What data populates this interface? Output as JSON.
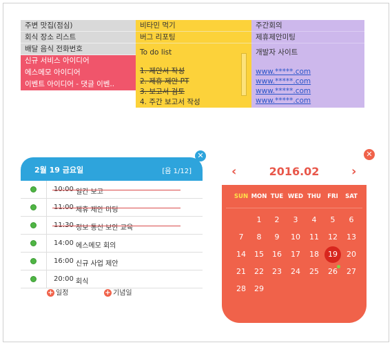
{
  "notes": {
    "col1": {
      "gray_items": [
        "주변 맛집(점심)",
        "회식 장소 리스트",
        "배달 음식 전화번호"
      ],
      "red_items": [
        "신규 서비스 아이디어",
        "에스메모 아이디어",
        "이벤트 아이디어 - 댓글 이벤.."
      ]
    },
    "col2": {
      "items": [
        "비타민 먹기",
        "버그 리포팅"
      ],
      "todo": {
        "title": "To do list",
        "done": [
          "1. 제안서 작성",
          "2. 제휴 제안 PT",
          "3. 보고서 검토"
        ],
        "pending": [
          "4. 주간 보고서 작성"
        ]
      }
    },
    "col3": {
      "items": [
        "주간회의",
        "제휴제안미팅"
      ],
      "site_title": "개발자 사이트",
      "links": [
        "www.*****.com",
        "www.*****.com",
        "www.*****.com",
        "www.*****.com"
      ]
    }
  },
  "schedule": {
    "close_label": "✕",
    "date": "2월 19 금요일",
    "page": "[음 1/12]",
    "rows": [
      {
        "time": "10:00",
        "title": "일간 보고",
        "done": true
      },
      {
        "time": "11:00",
        "title": "제휴 제안 미팅",
        "done": true
      },
      {
        "time": "11:30",
        "title": "정보 통신 보안 교육",
        "done": true
      },
      {
        "time": "14:00",
        "title": "에스메모 회의",
        "done": false
      },
      {
        "time": "16:00",
        "title": "신규 사업 제안",
        "done": false
      },
      {
        "time": "20:00",
        "title": "회식",
        "done": false
      }
    ],
    "add_schedule": "일정",
    "add_anniversary": "기념일"
  },
  "calendar": {
    "close_label": "✕",
    "prev_label": "‹",
    "next_label": "›",
    "title": "2016.02",
    "weekdays": [
      "SUN",
      "MON",
      "TUE",
      "WED",
      "THU",
      "FRI",
      "SAT"
    ],
    "first_weekday": 1,
    "days_in_month": 29,
    "today": 19,
    "event_days": [
      26
    ],
    "colors": {
      "sunday": "#ffe24a",
      "background": "#f0624a",
      "today": "#d8261e",
      "event": "#7ed64a"
    }
  }
}
